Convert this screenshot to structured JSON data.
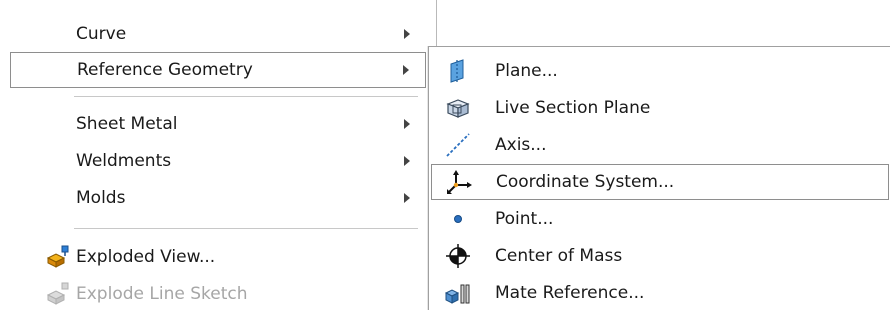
{
  "main_menu": {
    "items": [
      {
        "label": "Curve",
        "has_submenu": true
      },
      {
        "label": "Reference Geometry",
        "has_submenu": true,
        "highlighted": true
      },
      {
        "label": "Sheet Metal",
        "has_submenu": true
      },
      {
        "label": "Weldments",
        "has_submenu": true
      },
      {
        "label": "Molds",
        "has_submenu": true
      },
      {
        "label": "Exploded View...",
        "icon": "exploded-view-icon"
      },
      {
        "label": "Explode Line Sketch",
        "icon": "explode-line-sketch-icon",
        "disabled": true
      }
    ]
  },
  "sub_menu": {
    "items": [
      {
        "label": "Plane...",
        "icon": "plane-icon"
      },
      {
        "label": "Live Section Plane",
        "icon": "live-section-plane-icon"
      },
      {
        "label": "Axis...",
        "icon": "axis-icon"
      },
      {
        "label": "Coordinate System...",
        "icon": "coordinate-system-icon",
        "highlighted": true
      },
      {
        "label": "Point...",
        "icon": "point-icon"
      },
      {
        "label": "Center of Mass",
        "icon": "center-of-mass-icon"
      },
      {
        "label": "Mate Reference...",
        "icon": "mate-reference-icon"
      }
    ]
  }
}
